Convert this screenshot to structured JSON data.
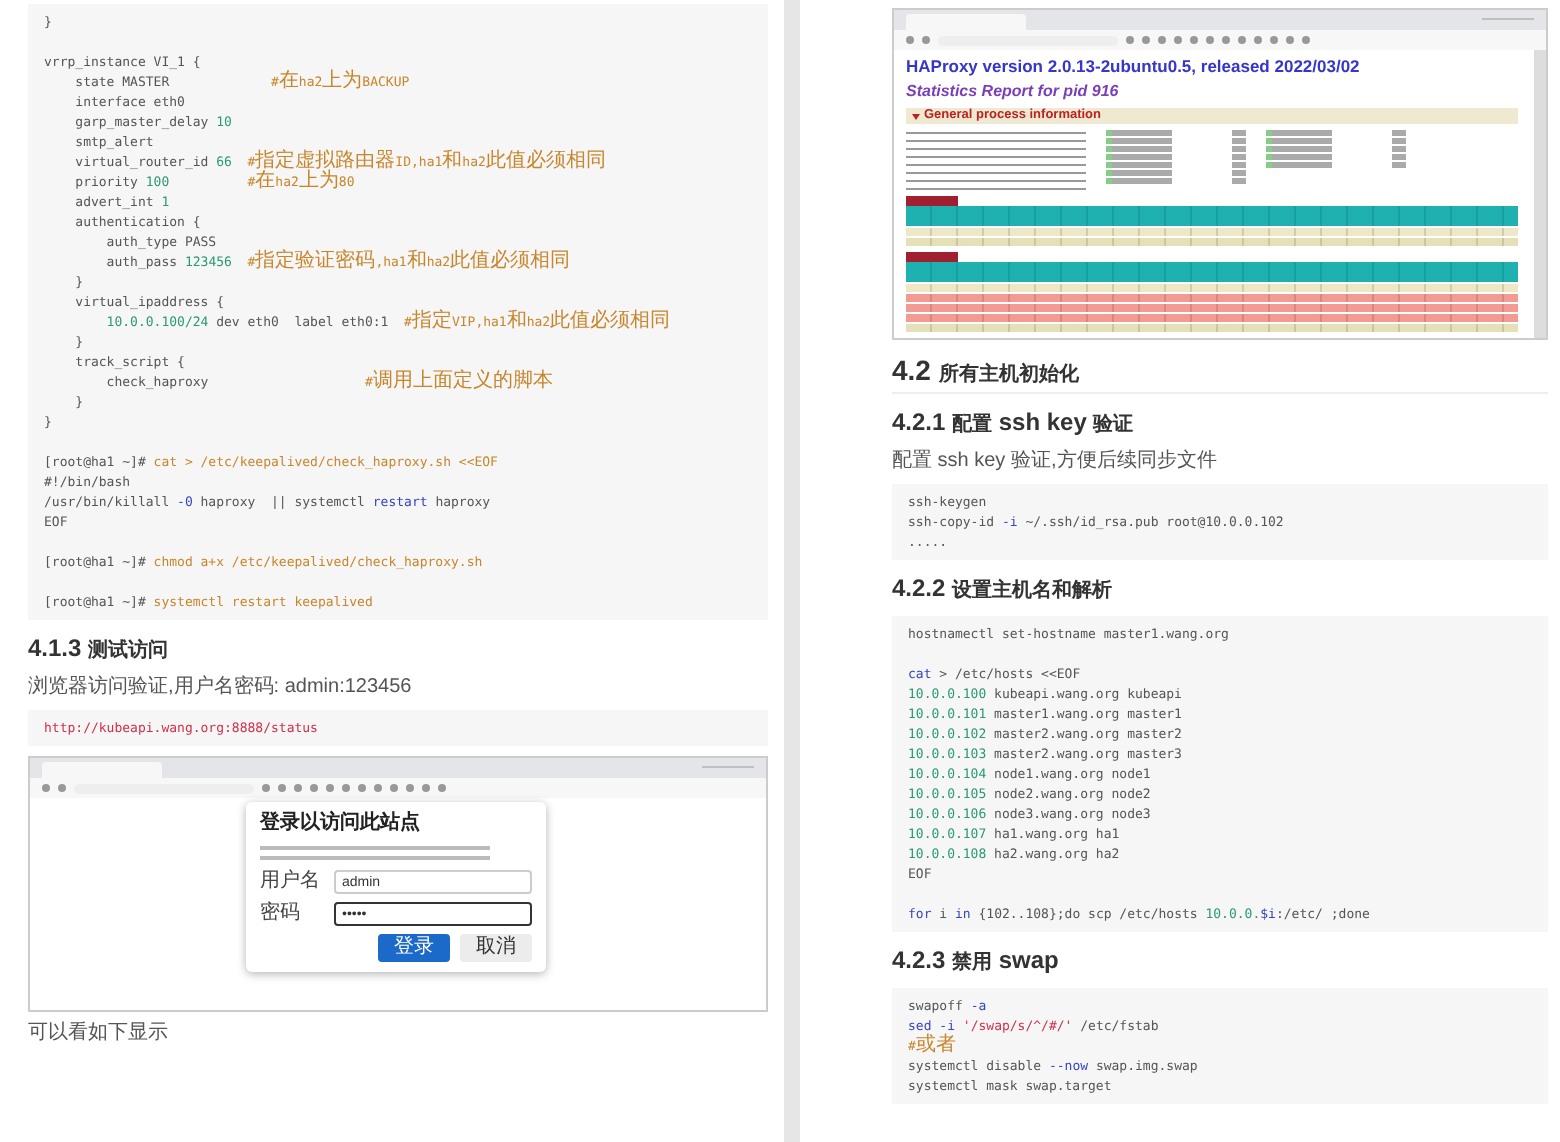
{
  "pages": [
    {
      "blocks": [
        {
          "kind": "code",
          "groups": [
            [
              [
                {
                  "text": "}"
                }
              ]
            ],
            [
              [
                {
                  "text": "vrrp_instance VI_1 {"
                }
              ],
              [
                {
                  "text": "    state MASTER             "
                },
                {
                  "text": "#在ha2上为BACKUP",
                  "kind": "comment"
                }
              ],
              [
                {
                  "text": "    interface eth0"
                }
              ],
              [
                {
                  "text": "    garp_master_delay "
                },
                {
                  "text": "10",
                  "kind": "number"
                }
              ],
              [
                {
                  "text": "    smtp_alert"
                }
              ],
              [
                {
                  "text": "    virtual_router_id "
                },
                {
                  "text": "66",
                  "kind": "number"
                },
                {
                  "text": "  #指定虚拟路由器ID,ha1和ha2此值必须相同",
                  "kind": "comment"
                }
              ],
              [
                {
                  "text": "    priority "
                },
                {
                  "text": "100",
                  "kind": "number"
                },
                {
                  "text": "          #在ha2上为80",
                  "kind": "comment"
                }
              ],
              [
                {
                  "text": "    advert_int "
                },
                {
                  "text": "1",
                  "kind": "number"
                }
              ],
              [
                {
                  "text": "    authentication {"
                }
              ],
              [
                {
                  "text": "        auth_type PASS"
                }
              ],
              [
                {
                  "text": "        auth_pass "
                },
                {
                  "text": "123456",
                  "kind": "number"
                },
                {
                  "text": "  #指定验证密码,ha1和ha2此值必须相同",
                  "kind": "comment"
                }
              ],
              [
                {
                  "text": "    }"
                }
              ],
              [
                {
                  "text": "    virtual_ipaddress {"
                }
              ],
              [
                {
                  "text": "        10.0.0.100/24",
                  "kind": "number"
                },
                {
                  "text": " dev eth0  label eth0:1  "
                },
                {
                  "text": "#指定VIP,ha1和ha2此值必须相同",
                  "kind": "comment"
                }
              ],
              [
                {
                  "text": "    }"
                }
              ],
              [
                {
                  "text": "    track_script {"
                }
              ],
              [
                {
                  "text": "        check_haproxy                    "
                },
                {
                  "text": "#调用上面定义的脚本",
                  "kind": "comment"
                }
              ],
              [
                {
                  "text": "    }"
                }
              ],
              [
                {
                  "text": "}"
                }
              ]
            ],
            [
              [
                {
                  "text": "[root@ha1 ~]#"
                },
                {
                  "text": " cat > /etc/keepalived/check_haproxy.sh <<EOF",
                  "kind": "comment"
                }
              ],
              [
                {
                  "text": "#!/bin/bash"
                }
              ],
              [
                {
                  "text": "/usr/bin/killall "
                },
                {
                  "text": "-0",
                  "kind": "keyword"
                },
                {
                  "text": " haproxy  || systemctl "
                },
                {
                  "text": "restart",
                  "kind": "keyword"
                },
                {
                  "text": " haproxy"
                }
              ],
              [
                {
                  "text": "EOF"
                }
              ]
            ],
            [
              [
                {
                  "text": "[root@ha1 ~]#"
                },
                {
                  "text": " chmod a+x /etc/keepalived/check_haproxy.sh",
                  "kind": "comment"
                }
              ]
            ],
            [
              [
                {
                  "text": "[root@ha1 ~]#"
                },
                {
                  "text": " systemctl restart keepalived",
                  "kind": "comment"
                }
              ]
            ]
          ]
        },
        {
          "kind": "h3",
          "text": "4.1.3 测试访问"
        },
        {
          "kind": "paragraph",
          "text": "浏览器访问验证,用户名密码: admin:123456"
        },
        {
          "kind": "code",
          "groups": [
            [
              [
                {
                  "text": "http://kubeapi.wang.org:8888/status",
                  "kind": "string"
                }
              ]
            ]
          ]
        },
        {
          "kind": "login-screenshot",
          "dialog": {
            "title": "登录以访问此站点",
            "fields": [
              {
                "label": "用户名",
                "value": "admin",
                "focused": false
              },
              {
                "label": "密码",
                "value": "•••••",
                "focused": true
              }
            ],
            "buttons": [
              {
                "label": "登录",
                "kind": "primary"
              },
              {
                "label": "取消",
                "kind": "secondary"
              }
            ]
          }
        },
        {
          "kind": "paragraph",
          "text": "可以看如下显示"
        }
      ]
    },
    {
      "blocks": [
        {
          "kind": "stats-screenshot",
          "title": "HAProxy version 2.0.13-2ubuntu0.5, released 2022/03/02",
          "subtitle": "Statistics Report for pid 916",
          "section": "General process information",
          "tables": [
            {
              "rows": [
                {
                  "kind": "frontend"
                },
                {
                  "kind": "backend"
                }
              ]
            },
            {
              "rows": [
                {
                  "kind": "frontend"
                },
                {
                  "kind": "server-down"
                },
                {
                  "kind": "server-down"
                },
                {
                  "kind": "server-down"
                },
                {
                  "kind": "backend"
                }
              ]
            }
          ]
        },
        {
          "kind": "h2",
          "text": "4.2 所有主机初始化"
        },
        {
          "kind": "h3",
          "text": "4.2.1 配置 ssh key 验证"
        },
        {
          "kind": "paragraph",
          "text": "配置 ssh key 验证,方便后续同步文件"
        },
        {
          "kind": "code",
          "groups": [
            [
              [
                {
                  "text": "ssh-keygen"
                }
              ],
              [
                {
                  "text": "ssh-copy-id "
                },
                {
                  "text": "-i",
                  "kind": "keyword"
                },
                {
                  "text": " ~/.ssh/id_rsa.pub root@10.0.0.102"
                }
              ],
              [
                {
                  "text": "....."
                }
              ]
            ]
          ]
        },
        {
          "kind": "h3",
          "text": "4.2.2 设置主机名和解析"
        },
        {
          "kind": "code",
          "groups": [
            [
              [
                {
                  "text": "hostnamectl set-hostname master1.wang.org"
                }
              ]
            ],
            [
              [
                {
                  "text": "cat",
                  "kind": "keyword"
                },
                {
                  "text": " > /etc/hosts <<EOF"
                }
              ],
              [
                {
                  "text": "10.0.0.100",
                  "kind": "number"
                },
                {
                  "text": " kubeapi.wang.org kubeapi"
                }
              ],
              [
                {
                  "text": "10.0.0.101",
                  "kind": "number"
                },
                {
                  "text": " master1.wang.org master1"
                }
              ],
              [
                {
                  "text": "10.0.0.102",
                  "kind": "number"
                },
                {
                  "text": " master2.wang.org master2"
                }
              ],
              [
                {
                  "text": "10.0.0.103",
                  "kind": "number"
                },
                {
                  "text": " master2.wang.org master3"
                }
              ],
              [
                {
                  "text": "10.0.0.104",
                  "kind": "number"
                },
                {
                  "text": " node1.wang.org node1"
                }
              ],
              [
                {
                  "text": "10.0.0.105",
                  "kind": "number"
                },
                {
                  "text": " node2.wang.org node2"
                }
              ],
              [
                {
                  "text": "10.0.0.106",
                  "kind": "number"
                },
                {
                  "text": " node3.wang.org node3"
                }
              ],
              [
                {
                  "text": "10.0.0.107",
                  "kind": "number"
                },
                {
                  "text": " ha1.wang.org ha1"
                }
              ],
              [
                {
                  "text": "10.0.0.108",
                  "kind": "number"
                },
                {
                  "text": " ha2.wang.org ha2"
                }
              ],
              [
                {
                  "text": "EOF"
                }
              ]
            ],
            [
              [
                {
                  "text": "for",
                  "kind": "keyword"
                },
                {
                  "text": " i "
                },
                {
                  "text": "in",
                  "kind": "keyword"
                },
                {
                  "text": " {102..108};do scp /etc/hosts "
                },
                {
                  "text": "10.0.0.",
                  "kind": "number"
                },
                {
                  "text": "$i",
                  "kind": "keyword"
                },
                {
                  "text": ":/etc/ ;done"
                }
              ]
            ]
          ]
        },
        {
          "kind": "h3",
          "text": "4.2.3 禁用 swap"
        },
        {
          "kind": "code",
          "groups": [
            [
              [
                {
                  "text": "swapoff "
                },
                {
                  "text": "-a",
                  "kind": "keyword"
                }
              ],
              [
                {
                  "text": "sed",
                  "kind": "keyword"
                },
                {
                  "text": " -i",
                  "kind": "keyword"
                },
                {
                  "text": " '/swap/s/^/#/'",
                  "kind": "string"
                },
                {
                  "text": " /etc/fstab"
                }
              ],
              [
                {
                  "text": "#或者",
                  "kind": "comment"
                }
              ],
              [
                {
                  "text": "systemctl disable "
                },
                {
                  "text": "--now",
                  "kind": "keyword"
                },
                {
                  "text": " swap.img.swap"
                }
              ],
              [
                {
                  "text": "systemctl mask swap.target"
                }
              ]
            ]
          ]
        }
      ]
    }
  ]
}
